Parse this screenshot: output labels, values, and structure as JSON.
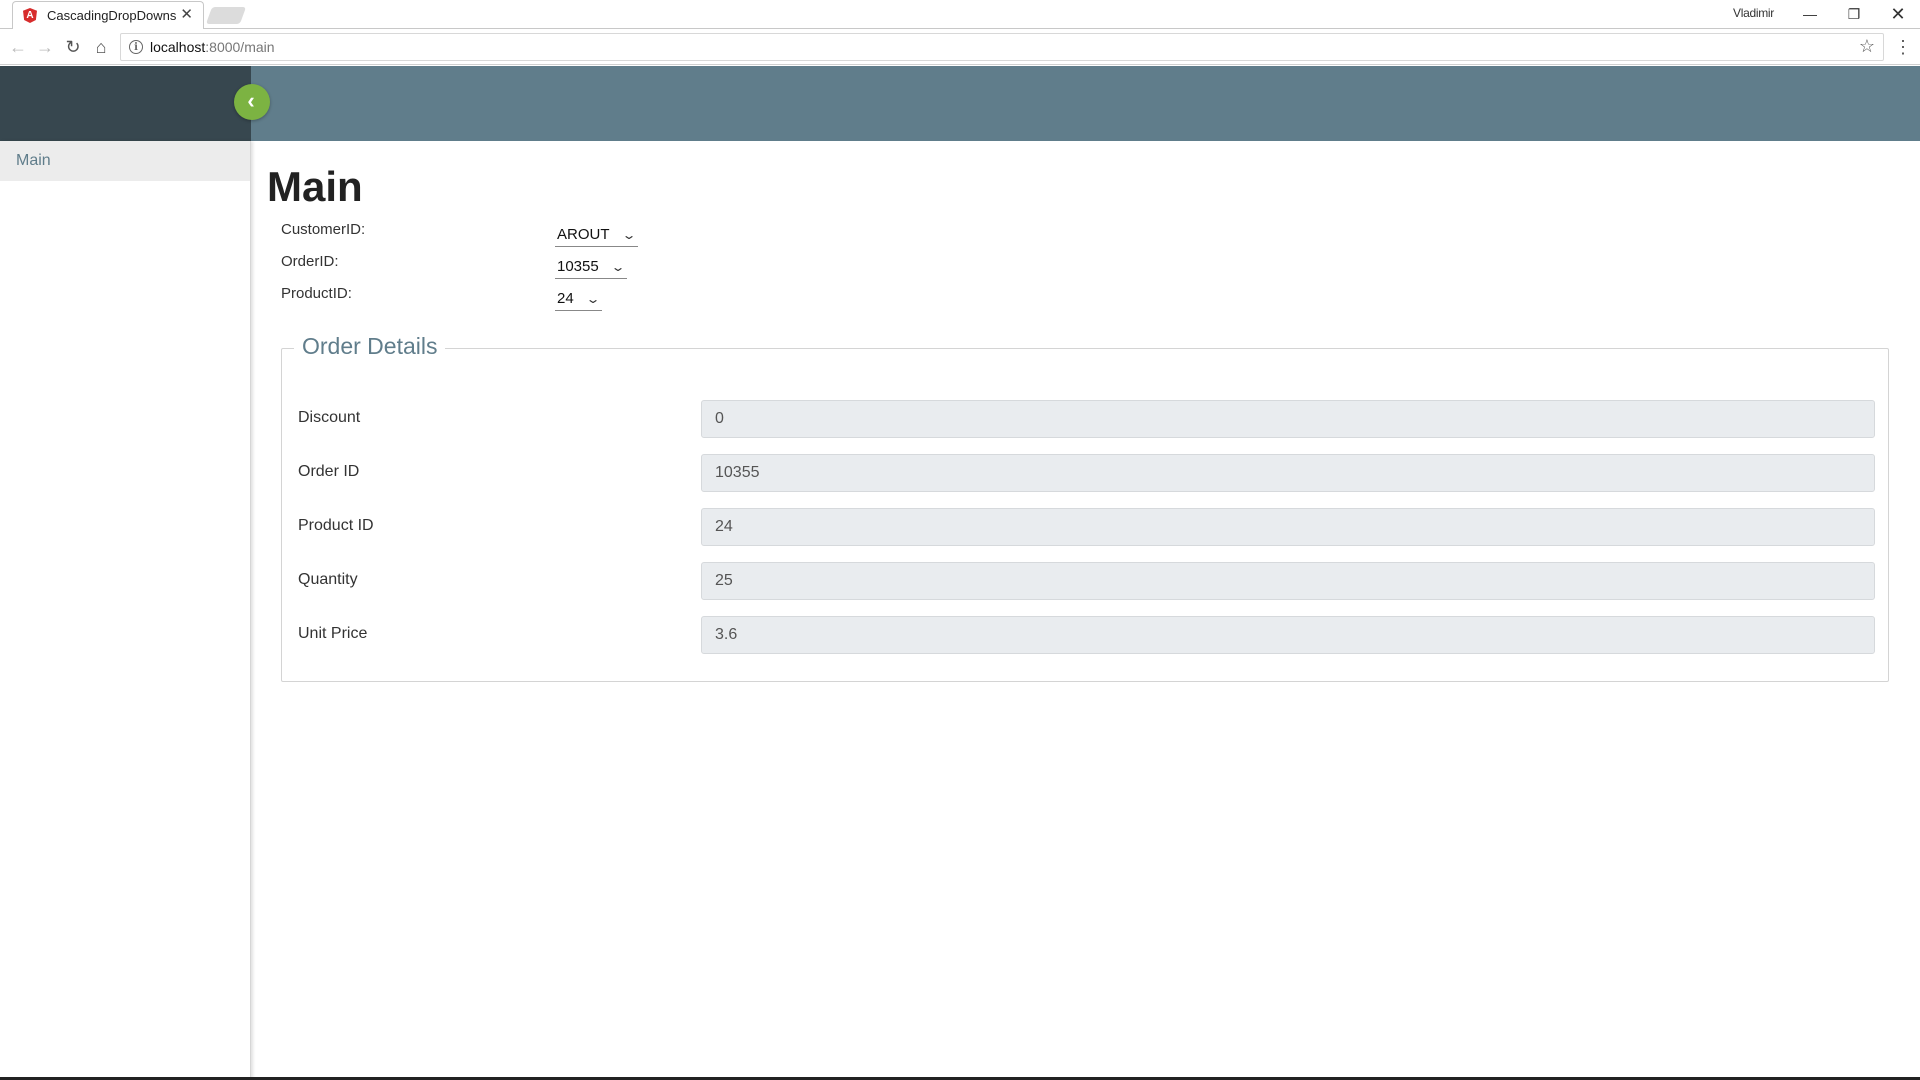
{
  "browser": {
    "tab_title": "CascadingDropDowns",
    "tab_close": "✕",
    "profile_name": "Vladimir",
    "url_host": "localhost",
    "url_path": ":8000/main",
    "icons": {
      "back": "←",
      "forward": "→",
      "reload": "↻",
      "home": "⌂",
      "info": "i",
      "star": "☆",
      "menu": "⋮",
      "minimize": "—",
      "maximize": "❐",
      "close": "✕",
      "favicon": "A"
    }
  },
  "app": {
    "header_color": "#607d8b",
    "sidebar_header_color": "#37474f",
    "accent_color": "#7cb342",
    "toggle_icon": "‹",
    "sidebar": {
      "items": [
        {
          "label": "Main"
        }
      ]
    },
    "main": {
      "title": "Main",
      "dropdowns": [
        {
          "label": "CustomerID:",
          "value": "AROUT",
          "chevron": "⌄"
        },
        {
          "label": "OrderID:",
          "value": "10355",
          "chevron": "⌄"
        },
        {
          "label": "ProductID:",
          "value": "24",
          "chevron": "⌄"
        }
      ],
      "order_details": {
        "legend": "Order Details",
        "fields": [
          {
            "label": "Discount",
            "value": "0"
          },
          {
            "label": "Order ID",
            "value": "10355"
          },
          {
            "label": "Product ID",
            "value": "24"
          },
          {
            "label": "Quantity",
            "value": "25"
          },
          {
            "label": "Unit Price",
            "value": "3.6"
          }
        ]
      }
    }
  }
}
